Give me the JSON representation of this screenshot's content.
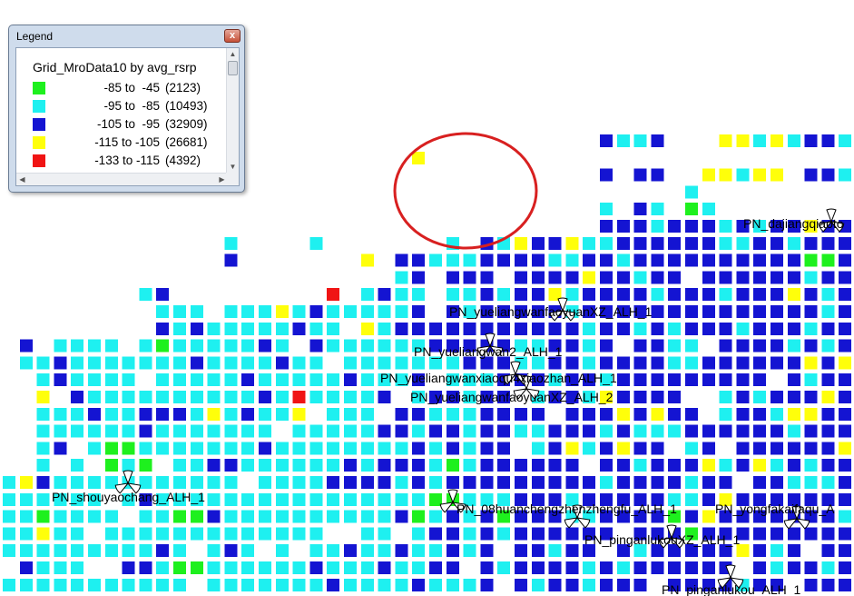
{
  "map": {
    "colors": {
      "green": "#1ef01e",
      "cyan": "#1ef0f0",
      "blue": "#1414d2",
      "yellow": "#ffff0a",
      "red": "#f01414",
      "highlight_circle": "#d82020"
    },
    "site_labels": [
      "PN_dajiangqiaoto",
      "PN_yueliangwanfaoyuanXZ_ALH_1",
      "PN_yueliangwan2_ALH_1",
      "PN_yueliangwanxiaoqu4xiaozhan_ALH_1",
      "PN_yueliangwanfaoyuanXZ_ALH_2",
      "PN_shouyaochang_ALH_1",
      "PN_08huanchengzhenzhengfu_ALH_1",
      "PN_yongfakaifaqu_A",
      "PN_pinganlukouXZ_ALH_1",
      "PN_pinganlukou_ALH_1"
    ]
  },
  "legend": {
    "title": "Legend",
    "close_glyph": "x",
    "layer_title": "Grid_MroData10 by avg_rsrp",
    "items": [
      {
        "range": "-85 to  -45",
        "count": "(2123)",
        "color": "#1ef01e"
      },
      {
        "range": "-95 to  -85",
        "count": "(10493)",
        "color": "#1ef0f0"
      },
      {
        "range": "-105 to  -95",
        "count": "(32909)",
        "color": "#1414d2"
      },
      {
        "range": "-115 to -105",
        "count": "(26681)",
        "color": "#ffff0a"
      },
      {
        "range": "-133 to -115",
        "count": "(4392)",
        "color": "#f01414"
      }
    ]
  }
}
